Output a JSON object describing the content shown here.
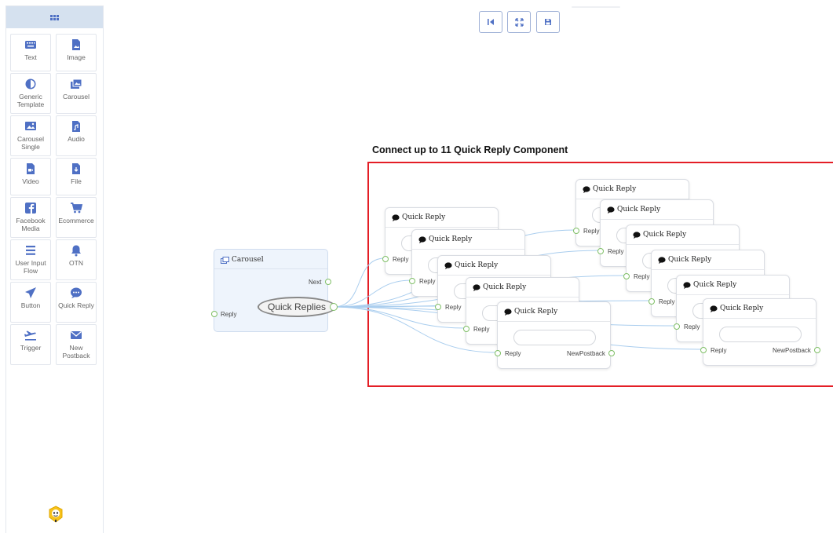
{
  "sidebar": {
    "items": [
      {
        "label": "Text",
        "icon": "keyboard-icon"
      },
      {
        "label": "Image",
        "icon": "image-file-icon"
      },
      {
        "label": "Generic Template",
        "icon": "half-circle-icon"
      },
      {
        "label": "Carousel",
        "icon": "carousel-icon"
      },
      {
        "label": "Carousel Single",
        "icon": "picture-icon"
      },
      {
        "label": "Audio",
        "icon": "audio-file-icon"
      },
      {
        "label": "Video",
        "icon": "video-file-icon"
      },
      {
        "label": "File",
        "icon": "download-file-icon"
      },
      {
        "label": "Facebook Media",
        "icon": "facebook-icon"
      },
      {
        "label": "Ecommerce",
        "icon": "cart-icon"
      },
      {
        "label": "User Input Flow",
        "icon": "lines-icon"
      },
      {
        "label": "OTN",
        "icon": "bell-icon"
      },
      {
        "label": "Button",
        "icon": "send-icon"
      },
      {
        "label": "Quick Reply",
        "icon": "chat-icon"
      },
      {
        "label": "Trigger",
        "icon": "plane-icon"
      },
      {
        "label": "New Postback",
        "icon": "envelope-icon"
      }
    ]
  },
  "toolbar": {
    "buttons": [
      {
        "icon": "reset-icon"
      },
      {
        "icon": "fit-screen-icon"
      },
      {
        "icon": "save-icon"
      }
    ]
  },
  "canvas": {
    "annotation": "Connect up to 11 Quick Reply Component",
    "carousel_node": {
      "title": "Carousel",
      "next_label": "Next",
      "reply_label": "Reply",
      "quick_replies_label": "Quick Replies"
    },
    "quick_reply_node": {
      "title": "Quick Reply",
      "reply_label": "Reply",
      "postback_label": "NewPostback"
    }
  },
  "colors": {
    "accent": "#4f70c4",
    "highlight_border": "#e41e26",
    "wire": "#a9cdee",
    "port": "#7fbf66",
    "carousel_bg": "#eef4fc"
  }
}
